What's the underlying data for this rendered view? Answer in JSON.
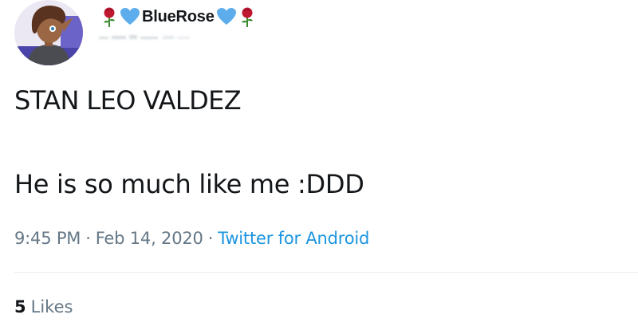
{
  "user": {
    "display_name": "BlueRose",
    "avatar": "cartoon-character-avatar",
    "emoji_left": [
      "rose-icon",
      "blue-heart-icon"
    ],
    "emoji_right": [
      "blue-heart-icon",
      "rose-icon"
    ]
  },
  "tweet": {
    "line1": "STAN LEO VALDEZ",
    "line2": "He is so much like me :DDD"
  },
  "meta": {
    "time": "9:45 PM",
    "separator": "·",
    "date": "Feb 14, 2020",
    "source": "Twitter for Android"
  },
  "stats": {
    "likes_count": "5",
    "likes_label": "Likes"
  },
  "colors": {
    "text": "#14171a",
    "secondary": "#657786",
    "link": "#1b95e0",
    "divider": "#e6ecf0",
    "heart": "#5dadec",
    "rose": "#be1931"
  }
}
